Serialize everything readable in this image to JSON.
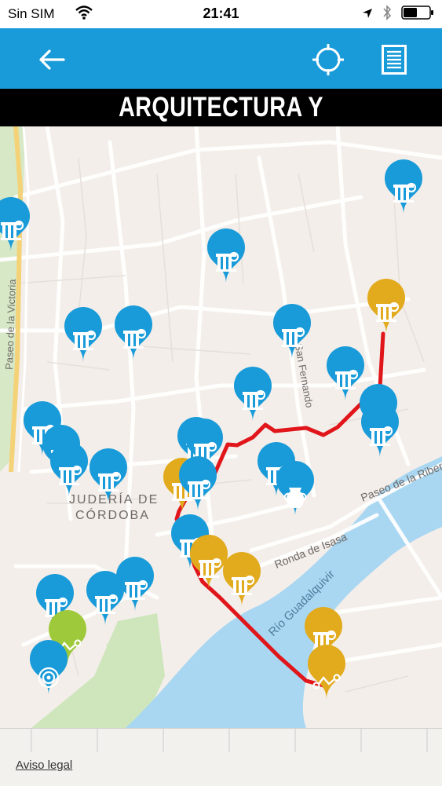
{
  "status": {
    "carrier": "Sin SIM",
    "time": "21:41"
  },
  "header": {
    "title": "ARQUITECTURA Y MONUMENTOS"
  },
  "icons": {
    "back": "back-arrow-icon",
    "locate": "crosshair-icon",
    "list": "list-icon"
  },
  "colors": {
    "appbar": "#1a9bd9",
    "pin_blue": "#1a9bd9",
    "pin_gold": "#e2aa1d",
    "pin_green": "#9ec93a",
    "route": "#e0161b",
    "water": "#a9d7f2",
    "park": "#cfe6bd"
  },
  "map": {
    "labels": {
      "paseo_victoria": "Paseo de la Victoria",
      "calle_san_fernando": "Calle San Fernando",
      "paseo_ribera": "Paseo de la Ribera",
      "ronda_isasa": "Ronda de Isasa",
      "rio": "Río Guadalquivir",
      "juderia_1": "JUDERÍA DE",
      "juderia_2": "CÓRDOBA"
    }
  },
  "footer": {
    "legal": "Aviso legal"
  }
}
